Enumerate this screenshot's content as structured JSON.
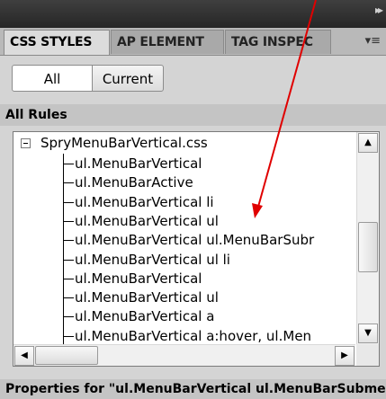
{
  "tabs": [
    {
      "label": "CSS STYLES"
    },
    {
      "label": "AP ELEMENT"
    },
    {
      "label": "TAG INSPEC"
    }
  ],
  "toggle": {
    "all_label": "All",
    "current_label": "Current",
    "selected": "All"
  },
  "section_title": "All Rules",
  "tree": {
    "root": "SpryMenuBarVertical.css",
    "rules": [
      "ul.MenuBarVertical",
      "ul.MenuBarActive",
      "ul.MenuBarVertical li",
      "ul.MenuBarVertical ul",
      "ul.MenuBarVertical ul.MenuBarSubr",
      "ul.MenuBarVertical ul li",
      "ul.MenuBarVertical",
      "ul.MenuBarVertical ul",
      "ul.MenuBarVertical a",
      "ul.MenuBarVertical a:hover, ul.Men"
    ]
  },
  "properties_header": "Properties for \"ul.MenuBarVertical ul.MenuBarSubmenuVisible\"",
  "colors": {
    "annotation_arrow": "#e00000",
    "panel_bg": "#d4d4d4",
    "topbar": "#2f2f2f"
  }
}
